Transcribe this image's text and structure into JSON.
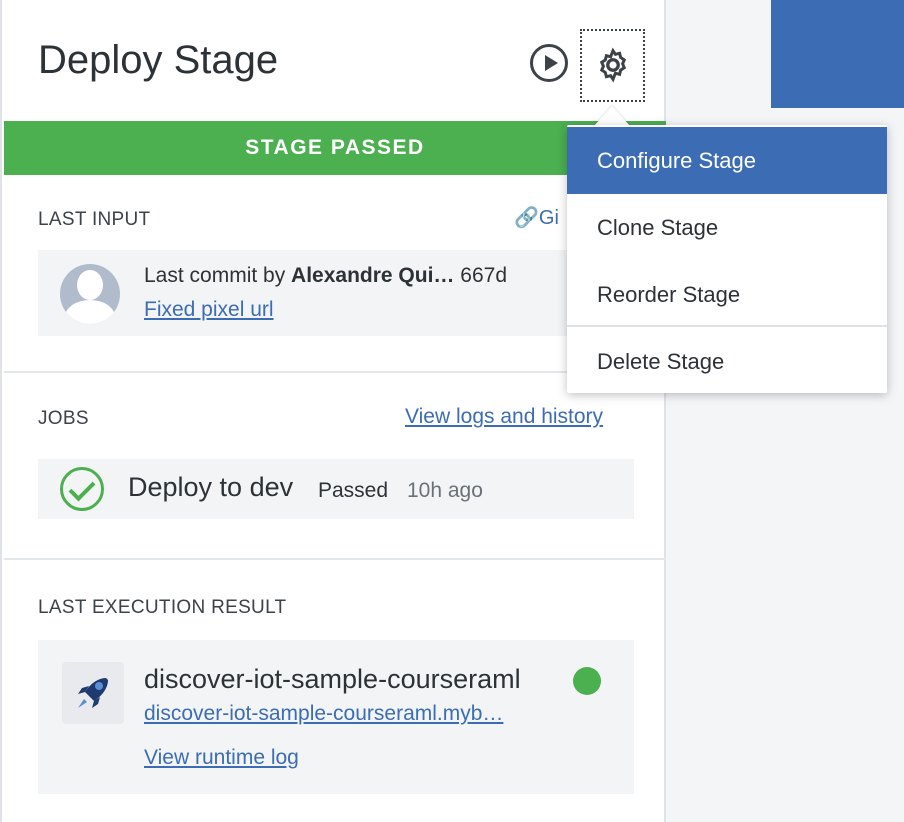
{
  "stage": {
    "title": "Deploy Stage",
    "banner": "STAGE PASSED"
  },
  "last_input": {
    "label": "LAST INPUT",
    "git_link": "Gi",
    "commit_prefix": "Last commit by ",
    "commit_author": "Alexandre Qui…",
    "commit_hash": "667d",
    "commit_message": "Fixed pixel url"
  },
  "jobs": {
    "label": "JOBS",
    "view_logs": "View logs and history",
    "items": [
      {
        "name": "Deploy to dev",
        "status": "Passed",
        "time": "10h ago"
      }
    ]
  },
  "last_execution": {
    "label": "LAST EXECUTION RESULT",
    "app_name": "discover-iot-sample-courseraml",
    "app_url": "discover-iot-sample-courseraml.myb…",
    "runtime_log": "View runtime log"
  },
  "menu": {
    "items": [
      {
        "label": "Configure Stage"
      },
      {
        "label": "Clone Stage"
      },
      {
        "label": "Reorder Stage"
      },
      {
        "label": "Delete Stage"
      }
    ]
  },
  "colors": {
    "accent": "#3c6db4",
    "success": "#4caf50"
  },
  "icons": {
    "play": "play-icon",
    "settings": "gear-icon",
    "link": "link-icon",
    "avatar": "user-avatar-icon",
    "check": "check-circle-icon",
    "app": "rocket-icon"
  }
}
